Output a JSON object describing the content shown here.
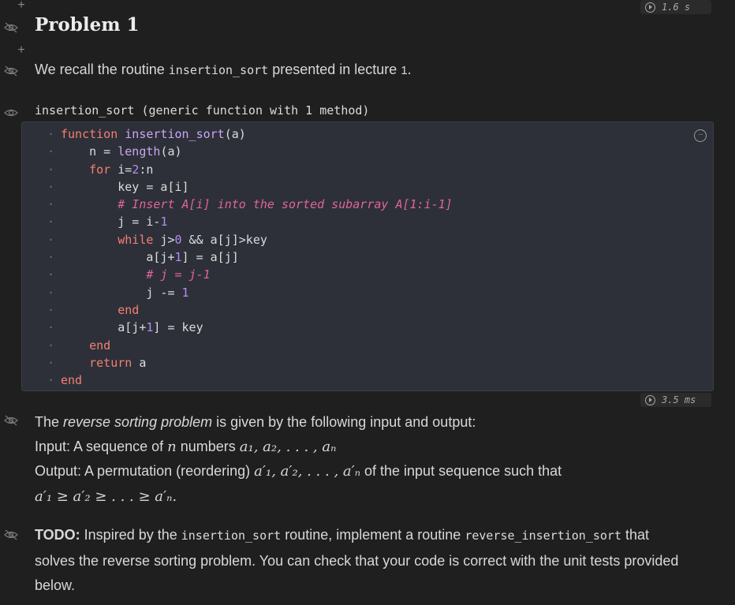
{
  "runtimes": {
    "top": "1.6 s",
    "code": "3.5 ms"
  },
  "heading": {
    "title": "Problem 1"
  },
  "intro": {
    "pre": "We recall the routine ",
    "code": "insertion_sort",
    "post": " presented in lecture ",
    "num": "1",
    "end": "."
  },
  "output_line": "insertion_sort (generic function with 1 method)",
  "code_lines": [
    "function insertion_sort(a)",
    "    n = length(a)",
    "    for i=2:n",
    "        key = a[i]",
    "        # Insert A[i] into the sorted subarray A[1:i-1]",
    "        j = i-1",
    "        while j>0 && a[j]>key",
    "            a[j+1] = a[j]",
    "            # j = j-1",
    "            j -= 1",
    "        end",
    "        a[j+1] = key",
    "    end",
    "    return a",
    "end"
  ],
  "reverse_problem": {
    "line1_pre": "The ",
    "line1_em": "reverse sorting problem",
    "line1_post": " is given by the following input and output:",
    "input_label": "Input: A sequence of ",
    "input_math_n": "n",
    "input_mid": " numbers ",
    "input_math_seq": "a₁, a₂, . . . , aₙ",
    "output_label": "Output: A permutation (reordering) ",
    "output_math_seq": "a′₁, a′₂, . . . , a′ₙ",
    "output_post": " of the input sequence such that",
    "condition": "a′₁ ≥ a′₂ ≥ . . . ≥ a′ₙ."
  },
  "todo": {
    "label": "TODO:",
    "pre": " Inspired by the ",
    "code1": "insertion_sort",
    "mid": " routine, implement a routine ",
    "code2": "reverse_insertion_sort",
    "post": " that",
    "line2": "solves the reverse sorting problem. You can check that your code is correct with the unit tests provided",
    "line3": "below."
  }
}
